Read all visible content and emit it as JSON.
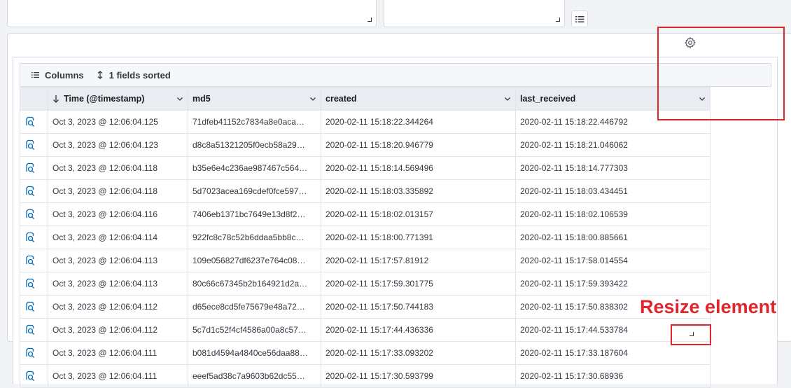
{
  "toolbar": {
    "columns_label": "Columns",
    "sort_label": "1 fields sorted"
  },
  "table": {
    "headers": [
      "Time (@timestamp)",
      "md5",
      "created",
      "last_received"
    ],
    "rows": [
      [
        "Oct 3, 2023 @ 12:06:04.125",
        "71dfeb41152c7834a8e0aca…",
        "2020-02-11 15:18:22.344264",
        "2020-02-11 15:18:22.446792"
      ],
      [
        "Oct 3, 2023 @ 12:06:04.123",
        "d8c8a51321205f0ecb58a29…",
        "2020-02-11 15:18:20.946779",
        "2020-02-11 15:18:21.046062"
      ],
      [
        "Oct 3, 2023 @ 12:06:04.118",
        "b35e6e4c236ae987467c564…",
        "2020-02-11 15:18:14.569496",
        "2020-02-11 15:18:14.777303"
      ],
      [
        "Oct 3, 2023 @ 12:06:04.118",
        "5d7023acea169cdef0fce597…",
        "2020-02-11 15:18:03.335892",
        "2020-02-11 15:18:03.434451"
      ],
      [
        "Oct 3, 2023 @ 12:06:04.116",
        "7406eb1371bc7649e13d8f2…",
        "2020-02-11 15:18:02.013157",
        "2020-02-11 15:18:02.106539"
      ],
      [
        "Oct 3, 2023 @ 12:06:04.114",
        "922fc8c78c52b6ddaa5bb8c…",
        "2020-02-11 15:18:00.771391",
        "2020-02-11 15:18:00.885661"
      ],
      [
        "Oct 3, 2023 @ 12:06:04.113",
        "109e056827df6237e764c08…",
        "2020-02-11 15:17:57.81912",
        "2020-02-11 15:17:58.014554"
      ],
      [
        "Oct 3, 2023 @ 12:06:04.113",
        "80c66c67345b2b164921d2a…",
        "2020-02-11 15:17:59.301775",
        "2020-02-11 15:17:59.393422"
      ],
      [
        "Oct 3, 2023 @ 12:06:04.112",
        "d65ece8cd5fe75679e48a72…",
        "2020-02-11 15:17:50.744183",
        "2020-02-11 15:17:50.838302"
      ],
      [
        "Oct 3, 2023 @ 12:06:04.112",
        "5c7d1c52f4cf4586a00a8c57…",
        "2020-02-11 15:17:44.436336",
        "2020-02-11 15:17:44.533784"
      ],
      [
        "Oct 3, 2023 @ 12:06:04.111",
        "b081d4594a4840ce56daa88…",
        "2020-02-11 15:17:33.093202",
        "2020-02-11 15:17:33.187604"
      ],
      [
        "Oct 3, 2023 @ 12:06:04.111",
        "eeef5ad38c7a9603b62dc55…",
        "2020-02-11 15:17:30.593799",
        "2020-02-11 15:17:30.68936"
      ]
    ]
  },
  "annotation": {
    "resize_label": "Resize element"
  },
  "colors": {
    "accent": "#006bb8",
    "annotation_red": "#e0262d",
    "header_bg": "#e9edf2",
    "border": "#d3dae6"
  },
  "icons": {
    "columns": "list-icon",
    "sort": "sort-arrows-icon",
    "settings": "gear-icon",
    "row_action": "inspect-document-icon",
    "header_menu": "chevron-down-icon",
    "sort_direction": "arrow-down-icon",
    "panel_menu": "list-icon"
  }
}
